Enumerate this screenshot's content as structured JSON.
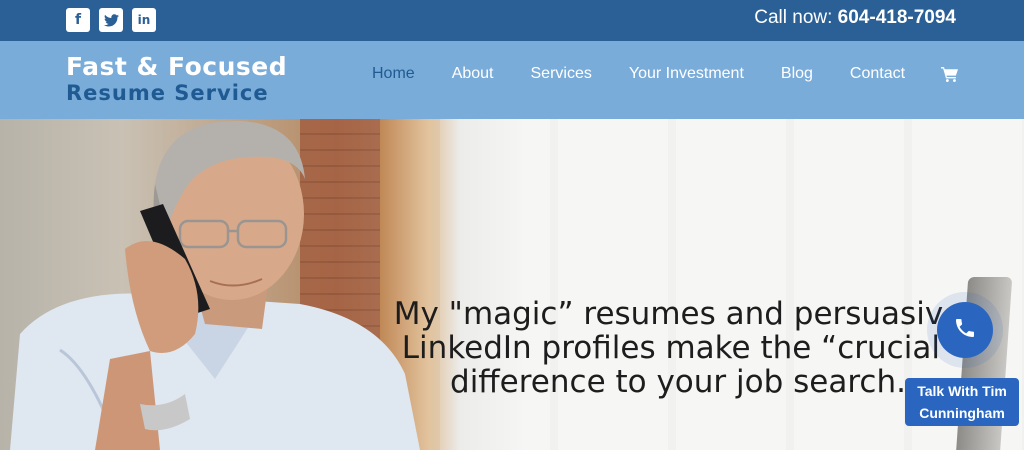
{
  "topbar": {
    "social": [
      {
        "name": "facebook",
        "glyph": "f"
      },
      {
        "name": "twitter",
        "glyph": ""
      },
      {
        "name": "linkedin",
        "glyph": "in"
      }
    ],
    "call_label": "Call now: ",
    "call_number": "604-418-7094",
    "background": "#2b6096"
  },
  "header": {
    "logo_line1": "Fast & Focused",
    "logo_line2": "Resume Service",
    "background": "#7aacda",
    "nav": [
      {
        "label": "Home",
        "active": true
      },
      {
        "label": "About"
      },
      {
        "label": "Services"
      },
      {
        "label": "Your Investment"
      },
      {
        "label": "Blog"
      },
      {
        "label": "Contact"
      }
    ],
    "cart_icon": "shopping-cart-icon"
  },
  "hero": {
    "headline": "My \"magic” resumes and persuasive\nLinkedIn profiles make the “crucial\"\ndifference to your job search."
  },
  "chat": {
    "button_icon": "phone-icon",
    "label": "Talk With Tim\nCunningham",
    "color": "#2a66c0"
  }
}
